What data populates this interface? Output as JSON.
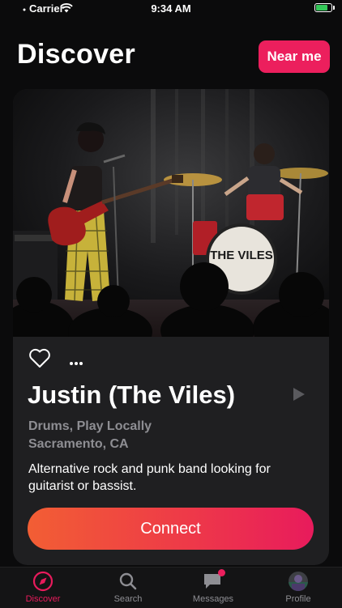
{
  "status_bar": {
    "carrier": "Carrier",
    "time": "9:34 AM"
  },
  "header": {
    "title": "Discover",
    "near_me_label": "Near me"
  },
  "card": {
    "name": "Justin (The Viles)",
    "tags": "Drums, Play Locally",
    "location": "Sacramento, CA",
    "description": "Alternative rock and punk band looking for guitarist or bassist.",
    "connect_label": "Connect",
    "photo_drum_text": "THE VILES"
  },
  "tabbar": {
    "tabs": [
      {
        "label": "Discover",
        "icon": "compass-icon",
        "active": true
      },
      {
        "label": "Search",
        "icon": "search-icon"
      },
      {
        "label": "Messages",
        "icon": "message-icon",
        "badge": true
      },
      {
        "label": "Profile",
        "icon": "avatar"
      }
    ]
  },
  "colors": {
    "accent": "#ec1f5d",
    "gradient_start": "#f25e34",
    "gradient_end": "#e81b5c"
  }
}
